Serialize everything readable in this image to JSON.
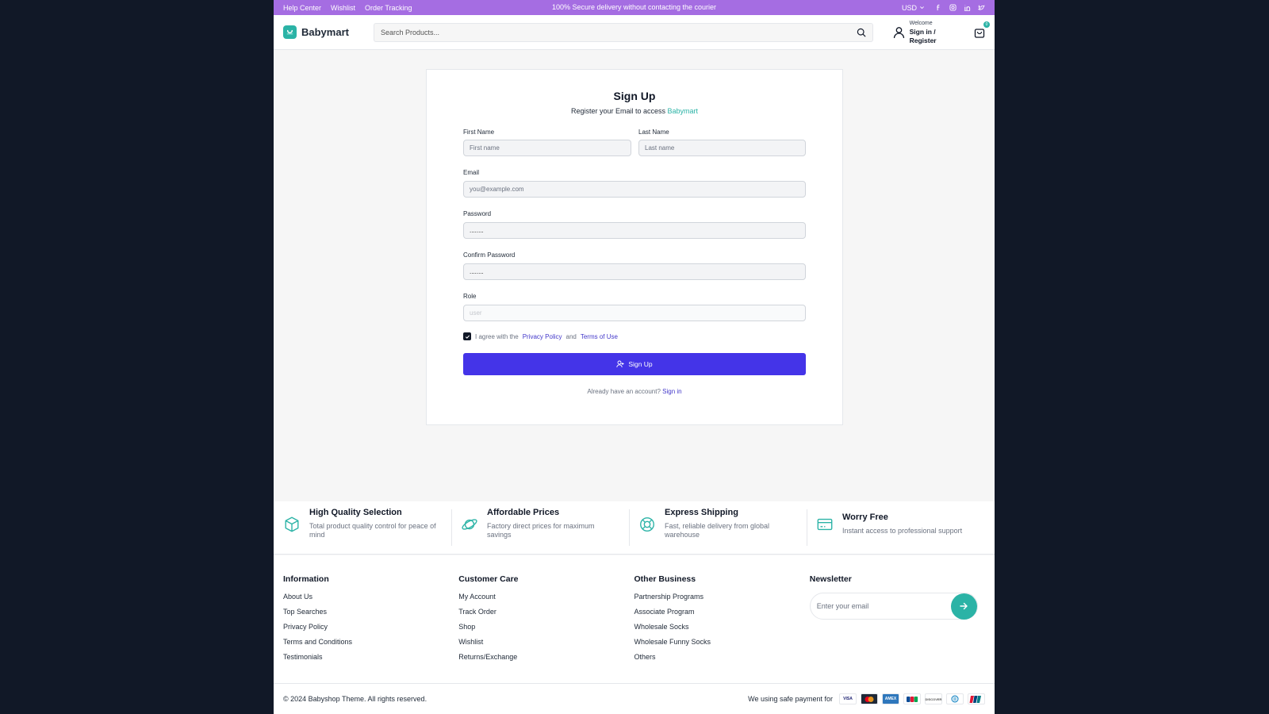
{
  "topbar": {
    "links": [
      "Help Center",
      "Wishlist",
      "Order Tracking"
    ],
    "promo": "100% Secure delivery without contacting the courier",
    "currency": "USD",
    "social_icons": [
      "facebook-icon",
      "instagram-icon",
      "linkedin-icon",
      "twitter-icon"
    ]
  },
  "header": {
    "brand": "Babymart",
    "search_placeholder": "Search Products...",
    "welcome": "Welcome",
    "signin": "Sign in / Register",
    "cart_count": "0"
  },
  "form": {
    "title": "Sign Up",
    "subtitle_prefix": "Register your Email to access",
    "subtitle_brand": "Babymart",
    "first_name_label": "First Name",
    "first_name_placeholder": "First name",
    "last_name_label": "Last Name",
    "last_name_placeholder": "Last name",
    "email_label": "Email",
    "email_placeholder": "you@example.com",
    "password_label": "Password",
    "password_value": "........",
    "confirm_label": "Confirm Password",
    "confirm_value": "........",
    "role_label": "Role",
    "role_placeholder": "user",
    "agree_prefix": "I agree with the",
    "privacy_link": "Privacy Policy",
    "and_text": "and",
    "terms_link": "Terms of Use",
    "agree_checked": true,
    "submit_label": "Sign Up",
    "already_text": "Already have an account?",
    "signin_link": "Sign in"
  },
  "features": [
    {
      "title": "High Quality Selection",
      "desc": "Total product quality control for peace of mind",
      "icon": "box-icon"
    },
    {
      "title": "Affordable Prices",
      "desc": "Factory direct prices for maximum savings",
      "icon": "planet-icon"
    },
    {
      "title": "Express Shipping",
      "desc": "Fast, reliable delivery from global warehouse",
      "icon": "lifebuoy-icon"
    },
    {
      "title": "Worry Free",
      "desc": "Instant access to professional support",
      "icon": "credit-card-icon"
    }
  ],
  "footer": {
    "information": {
      "title": "Information",
      "items": [
        "About Us",
        "Top Searches",
        "Privacy Policy",
        "Terms and Conditions",
        "Testimonials"
      ]
    },
    "customer_care": {
      "title": "Customer Care",
      "items": [
        "My Account",
        "Track Order",
        "Shop",
        "Wishlist",
        "Returns/Exchange"
      ]
    },
    "other_business": {
      "title": "Other Business",
      "items": [
        "Partnership Programs",
        "Associate Program",
        "Wholesale Socks",
        "Wholesale Funny Socks",
        "Others"
      ]
    },
    "newsletter": {
      "title": "Newsletter",
      "placeholder": "Enter your email"
    },
    "copyright": "© 2024 Babyshop Theme. All rights reserved.",
    "payment_label": "We using safe payment for",
    "payment_icons": [
      "visa-icon",
      "mastercard-icon",
      "amex-icon",
      "jcb-icon",
      "discover-icon",
      "diners-icon",
      "unionpay-icon"
    ]
  },
  "colors": {
    "topbar": "#a56de2",
    "accent": "#2bb3a6",
    "primary_button": "#4434e8",
    "link": "#4338ca"
  }
}
